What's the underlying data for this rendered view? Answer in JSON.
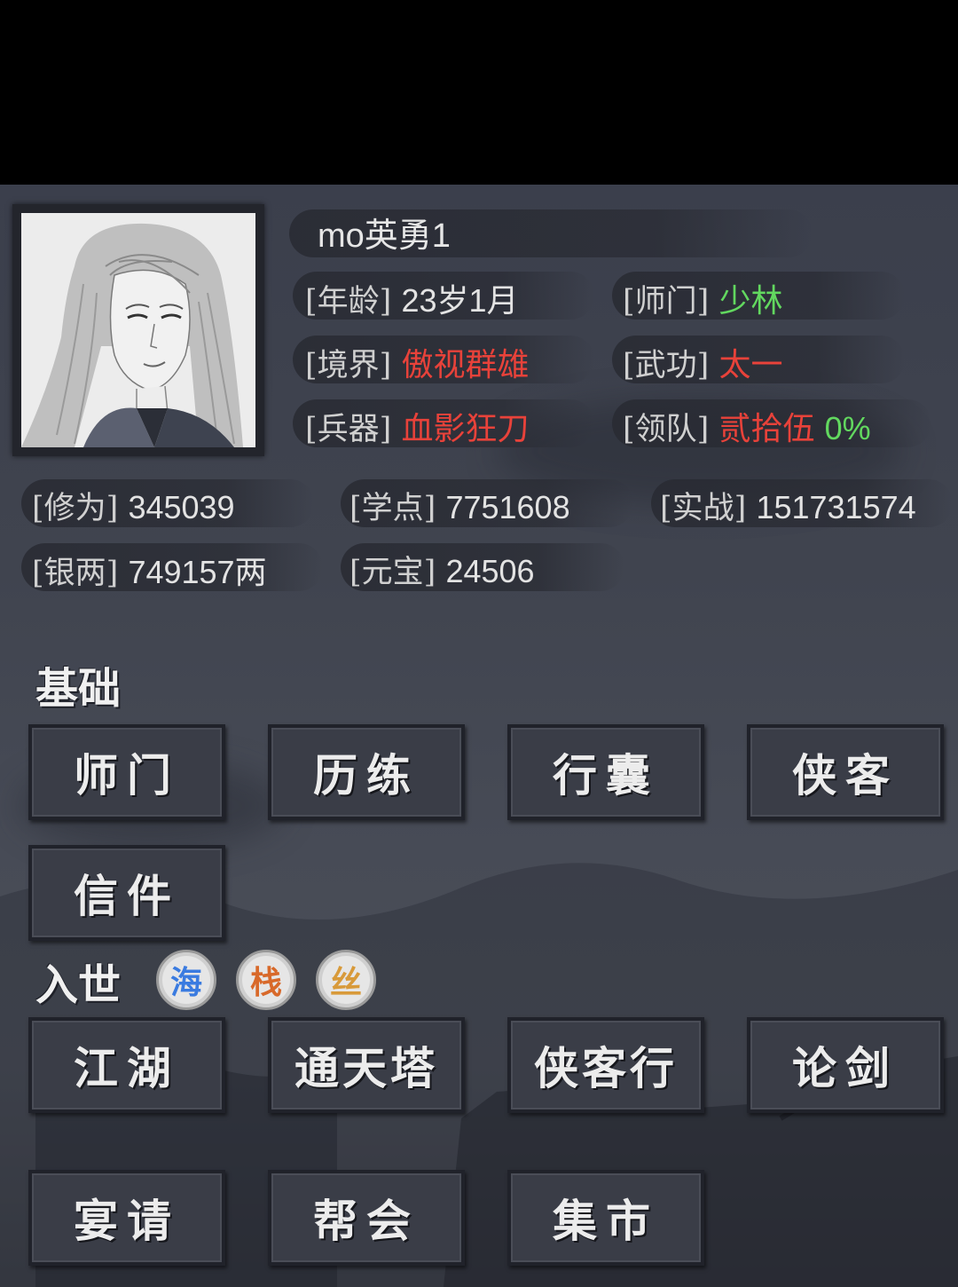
{
  "player": {
    "name": "mo英勇1"
  },
  "stats_top": [
    {
      "label": "[年龄]",
      "value": "23岁1月",
      "color": "#e3e3e3"
    },
    {
      "label": "[师门]",
      "value": "少林",
      "color": "#62d85f"
    },
    {
      "label": "[境界]",
      "value": "傲视群雄",
      "color": "#e8423a"
    },
    {
      "label": "[武功]",
      "value": "太一",
      "color": "#e8423a"
    },
    {
      "label": "[兵器]",
      "value": "血影狂刀",
      "color": "#e8423a"
    },
    {
      "label": "[领队]",
      "value": "贰拾伍",
      "extra": "0%",
      "color": "#e8423a",
      "extra_color": "#62d85f"
    }
  ],
  "stats_bottom": [
    {
      "label": "[修为]",
      "value": "345039"
    },
    {
      "label": "[学点]",
      "value": "7751608"
    },
    {
      "label": "[实战]",
      "value": "151731574"
    },
    {
      "label": "[银两]",
      "value": "749157两"
    },
    {
      "label": "[元宝]",
      "value": "24506"
    }
  ],
  "sections": {
    "basic": {
      "title": "基础",
      "buttons": [
        "师门",
        "历练",
        "行囊",
        "侠客",
        "信件"
      ]
    },
    "world": {
      "title": "入世",
      "badges": [
        {
          "text": "海",
          "color": "#3a7be0"
        },
        {
          "text": "栈",
          "color": "#d8692a"
        },
        {
          "text": "丝",
          "color": "#d89a3a"
        }
      ],
      "buttons": [
        "江湖",
        "通天塔",
        "侠客行",
        "论剑",
        "宴请",
        "帮会",
        "集市"
      ]
    }
  }
}
